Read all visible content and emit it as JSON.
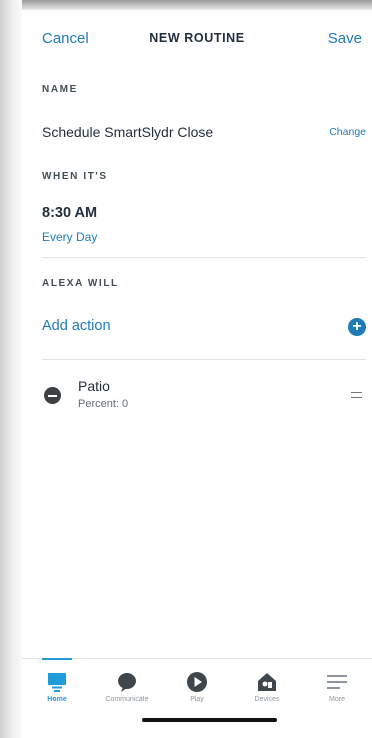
{
  "header": {
    "cancel_label": "Cancel",
    "title": "NEW ROUTINE",
    "save_label": "Save"
  },
  "name_section": {
    "label": "NAME",
    "value": "Schedule SmartSlydr Close",
    "change_label": "Change"
  },
  "when_section": {
    "label": "WHEN IT'S",
    "time": "8:30 AM",
    "frequency": "Every Day"
  },
  "alexa_section": {
    "label": "ALEXA WILL",
    "add_action_label": "Add action",
    "actions": [
      {
        "name": "Patio",
        "detail": "Percent: 0"
      }
    ]
  },
  "bottom_nav": {
    "items": [
      {
        "label": "Home",
        "icon": "home-icon",
        "active": true
      },
      {
        "label": "Communicate",
        "icon": "chat-bubble-icon",
        "active": false
      },
      {
        "label": "Play",
        "icon": "play-icon",
        "active": false
      },
      {
        "label": "Devices",
        "icon": "devices-house-icon",
        "active": false
      },
      {
        "label": "More",
        "icon": "menu-lines-icon",
        "active": false
      }
    ]
  },
  "colors": {
    "accent": "#1f7bb5",
    "active_nav": "#1f9bd8",
    "text": "#232f3e"
  }
}
